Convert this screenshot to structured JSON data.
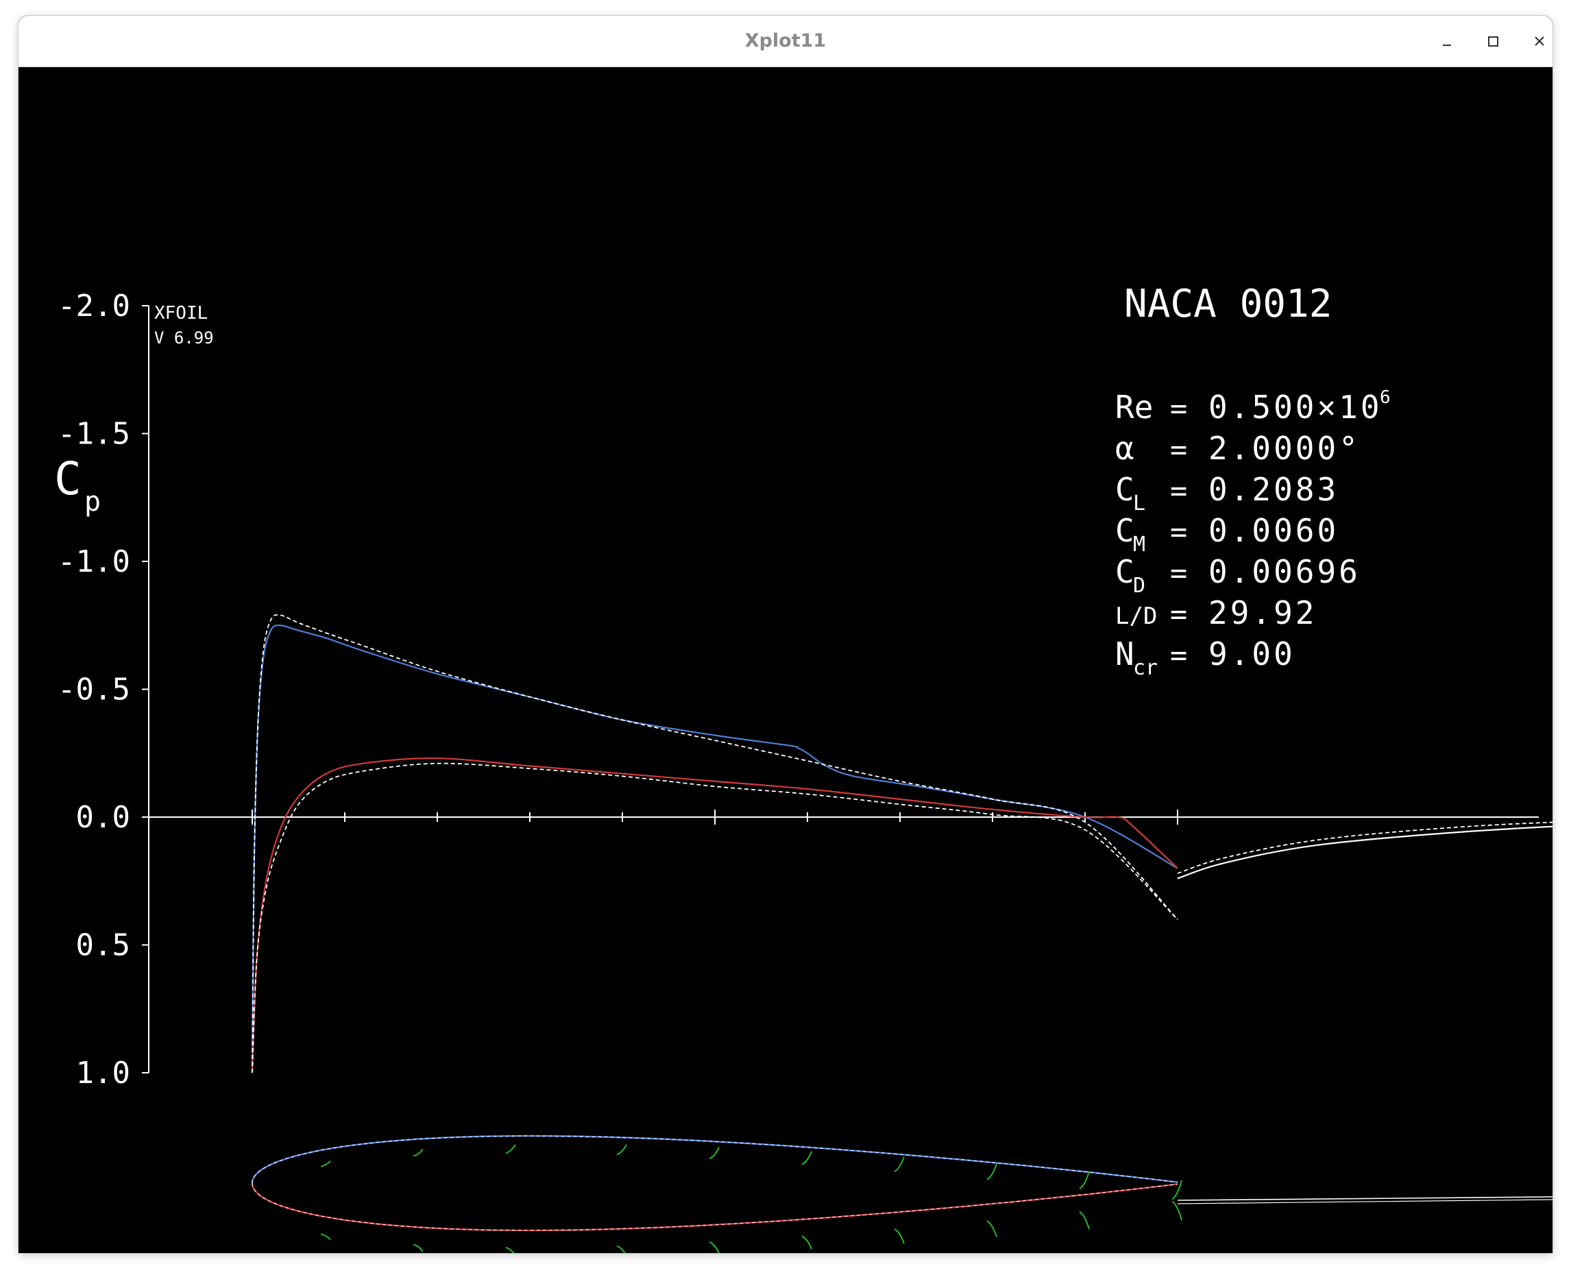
{
  "window": {
    "title": "Xplot11",
    "controls": [
      "minimize-icon",
      "maximize-icon",
      "close-icon"
    ]
  },
  "plot": {
    "program": "XFOIL",
    "version": "V 6.99",
    "airfoil": "NACA 0012",
    "ylabel_main": "C",
    "ylabel_sub": "p",
    "y_ticks": [
      "-2.0",
      "-1.5",
      "-1.0",
      "-0.5",
      "0.0",
      "0.5",
      "1.0"
    ],
    "params": [
      {
        "label": "Re",
        "sub": "",
        "eq": "=",
        "value": "0.500×10",
        "sup": "6"
      },
      {
        "label": "α",
        "sub": "",
        "eq": "=",
        "value": "2.0000°",
        "sup": ""
      },
      {
        "label": "C",
        "sub": "L",
        "eq": "=",
        "value": "0.2083",
        "sup": ""
      },
      {
        "label": "C",
        "sub": "M",
        "eq": "=",
        "value": "0.0060",
        "sup": ""
      },
      {
        "label": "C",
        "sub": "D",
        "eq": "=",
        "value": "0.00696",
        "sup": ""
      },
      {
        "label": "L/D",
        "sub": "",
        "eq": "=",
        "value": "29.92",
        "sup": ""
      },
      {
        "label": "N",
        "sub": "cr",
        "eq": "=",
        "value": "9.00",
        "sup": ""
      }
    ],
    "colors": {
      "background": "#000000",
      "axes": "#ffffff",
      "upper_surface": "#4f7fd6",
      "lower_surface": "#d23a3a",
      "inviscid": "#ffffff",
      "boundary_layer": "#22cc22",
      "title": "#ffffff"
    }
  },
  "chart_data": {
    "type": "line",
    "title": "NACA 0012",
    "ylabel": "Cp",
    "ylim": [
      -2.0,
      1.0
    ],
    "y_inverted": true,
    "x_range": [
      0.0,
      1.0
    ],
    "x_ticks": [
      0.0,
      0.1,
      0.2,
      0.3,
      0.4,
      0.5,
      0.6,
      0.7,
      0.8,
      0.9,
      1.0
    ],
    "grid": false,
    "series": [
      {
        "style": "solid",
        "color": "#4f7fd6",
        "x": [
          0.0,
          0.002,
          0.006,
          0.012,
          0.02,
          0.03,
          0.05,
          0.08,
          0.12,
          0.2,
          0.3,
          0.4,
          0.5,
          0.58,
          0.59,
          0.6,
          0.62,
          0.65,
          0.72,
          0.8,
          0.9,
          1.0
        ],
        "y": [
          1.0,
          0.2,
          -0.35,
          -0.62,
          -0.73,
          -0.75,
          -0.73,
          -0.7,
          -0.65,
          -0.56,
          -0.47,
          -0.38,
          -0.32,
          -0.28,
          -0.27,
          -0.25,
          -0.2,
          -0.16,
          -0.12,
          -0.07,
          0.0,
          0.2
        ]
      },
      {
        "style": "solid",
        "color": "#d23a3a",
        "x": [
          0.0,
          0.005,
          0.015,
          0.03,
          0.05,
          0.08,
          0.12,
          0.2,
          0.3,
          0.4,
          0.5,
          0.6,
          0.7,
          0.8,
          0.9,
          0.935,
          0.95,
          1.0
        ],
        "y": [
          1.0,
          0.55,
          0.25,
          0.05,
          -0.08,
          -0.17,
          -0.21,
          -0.23,
          -0.2,
          -0.17,
          -0.14,
          -0.11,
          -0.07,
          -0.03,
          0.0,
          0.0,
          0.03,
          0.2
        ]
      },
      {
        "style": "dashed",
        "color": "#ffffff",
        "x": [
          0.0,
          0.002,
          0.006,
          0.012,
          0.02,
          0.03,
          0.05,
          0.08,
          0.12,
          0.2,
          0.3,
          0.4,
          0.5,
          0.6,
          0.7,
          0.8,
          0.9,
          1.0
        ],
        "y": [
          1.0,
          0.2,
          -0.35,
          -0.65,
          -0.77,
          -0.79,
          -0.76,
          -0.72,
          -0.67,
          -0.57,
          -0.47,
          -0.38,
          -0.3,
          -0.22,
          -0.14,
          -0.07,
          0.02,
          0.4
        ]
      },
      {
        "style": "dashed",
        "color": "#ffffff",
        "x": [
          0.0,
          0.005,
          0.015,
          0.03,
          0.05,
          0.08,
          0.12,
          0.2,
          0.3,
          0.4,
          0.5,
          0.6,
          0.7,
          0.8,
          0.9,
          1.0
        ],
        "y": [
          1.0,
          0.55,
          0.28,
          0.1,
          -0.05,
          -0.14,
          -0.18,
          -0.21,
          -0.19,
          -0.16,
          -0.12,
          -0.09,
          -0.05,
          -0.01,
          0.05,
          0.4
        ]
      },
      {
        "name": "wake",
        "style": "solid",
        "color": "#ffffff",
        "x": [
          1.0,
          1.05,
          1.15,
          1.3,
          1.45,
          1.6
        ],
        "y": [
          0.24,
          0.18,
          0.11,
          0.06,
          0.03,
          0.02
        ]
      },
      {
        "name": "wake-inviscid",
        "style": "dashed",
        "color": "#ffffff",
        "x": [
          1.0,
          1.05,
          1.15,
          1.3,
          1.45,
          1.6
        ],
        "y": [
          0.22,
          0.16,
          0.09,
          0.04,
          0.015,
          0.01
        ]
      }
    ]
  }
}
